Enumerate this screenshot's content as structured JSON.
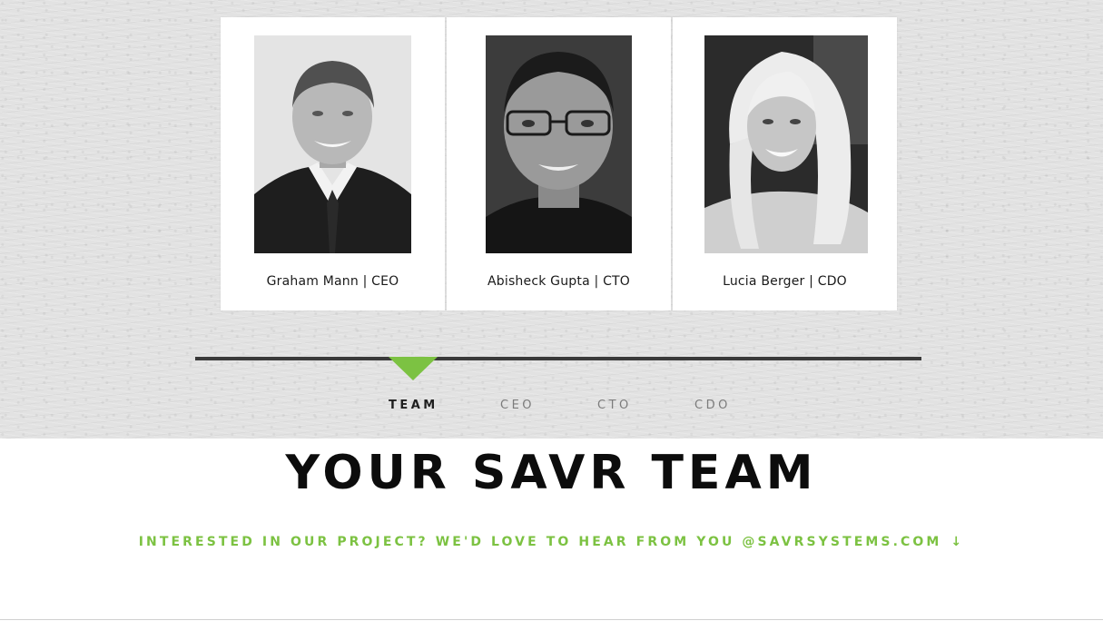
{
  "team_members": [
    {
      "caption": "Graham Mann | CEO",
      "photo_icon": "portrait-photo"
    },
    {
      "caption": "Abisheck Gupta | CTO",
      "photo_icon": "portrait-photo"
    },
    {
      "caption": "Lucia Berger | CDO",
      "photo_icon": "portrait-photo"
    }
  ],
  "timeline": {
    "tabs": [
      "TEAM",
      "CEO",
      "CTO",
      "CDO"
    ],
    "active_tab": "TEAM",
    "accent_color": "#7cc242",
    "bar_color": "#3a3a3a"
  },
  "section": {
    "title": "YOUR SAVR TEAM",
    "contact_line": "INTERESTED IN OUR PROJECT? WE'D LOVE TO HEAR FROM YOU @SAVRSYSTEMS.COM",
    "contact_arrow": "↓"
  },
  "colors": {
    "accent": "#7cc242",
    "title": "#0c0c0c",
    "inactive_tab": "#7b7b7b"
  }
}
